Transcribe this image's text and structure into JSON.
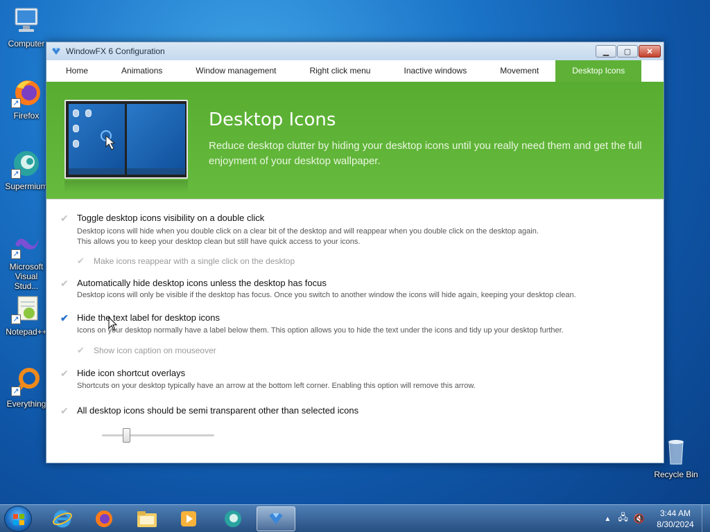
{
  "desktop": {
    "icons": [
      {
        "label": "Computer"
      },
      {
        "label": "Firefox"
      },
      {
        "label": "Supermium"
      },
      {
        "label": "Microsoft Visual Stud..."
      },
      {
        "label": "Notepad++"
      },
      {
        "label": "Everything"
      },
      {
        "label": "Recycle Bin"
      }
    ]
  },
  "window": {
    "title": "WindowFX 6 Configuration",
    "tabs": [
      {
        "label": "Home"
      },
      {
        "label": "Animations"
      },
      {
        "label": "Window management"
      },
      {
        "label": "Right click menu"
      },
      {
        "label": "Inactive windows"
      },
      {
        "label": "Movement"
      },
      {
        "label": "Desktop Icons",
        "active": true
      }
    ],
    "banner": {
      "heading": "Desktop Icons",
      "text": "Reduce desktop clutter by hiding your desktop icons until you really need them and get the full enjoyment of your desktop wallpaper."
    },
    "options": [
      {
        "label": "Toggle desktop icons visibility on a double click",
        "checked": false,
        "desc1": "Desktop icons will hide when you double click on a clear bit of the desktop and will reappear when you double click on the desktop again.",
        "desc2": "This allows you to keep your desktop clean but still have quick access to your icons."
      },
      {
        "label": "Make icons reappear with a single click on the desktop",
        "checked": false,
        "disabled": true
      },
      {
        "label": "Automatically hide desktop icons unless the desktop has focus",
        "checked": false,
        "desc1": "Desktop icons will only be visible if the desktop has focus.  Once you switch to another window the icons will hide again, keeping your desktop clean."
      },
      {
        "label": "Hide the text label for desktop icons",
        "checked": true,
        "desc1": "Icons on your desktop normally have a label below them.  This option allows you to hide the text under the icons and tidy up your desktop further."
      },
      {
        "label": "Show icon caption on mouseover",
        "checked": false,
        "disabled": true
      },
      {
        "label": "Hide icon shortcut overlays",
        "checked": false,
        "desc1": "Shortcuts on your desktop typically have an arrow at the bottom left corner.  Enabling this option will remove this arrow."
      },
      {
        "label": "All desktop icons should be semi transparent other than selected icons",
        "checked": false
      }
    ],
    "transparency_slider": {
      "value_fraction": 0.2
    }
  },
  "taskbar": {
    "clock_time": "3:44 AM",
    "clock_date": "8/30/2024"
  },
  "colors": {
    "accent_green": "#5eb136",
    "check_blue": "#2a6fd0"
  }
}
